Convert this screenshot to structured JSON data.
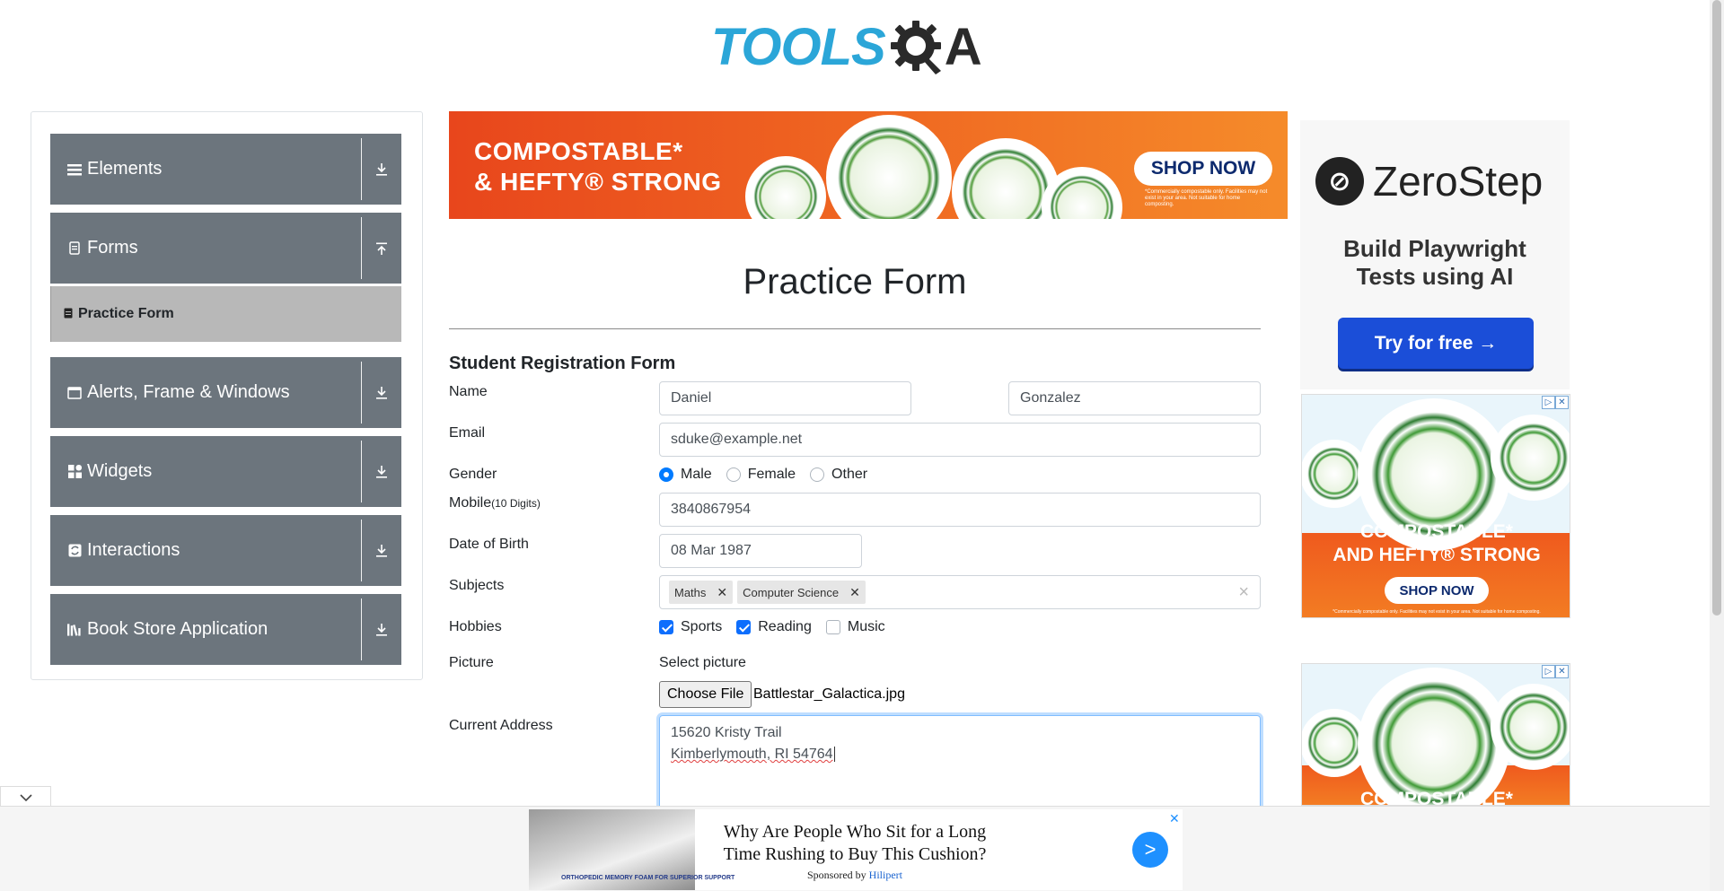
{
  "header": {
    "logo_tools": "TOOLS",
    "logo_a": "A"
  },
  "sidebar": {
    "groups": [
      {
        "label": "Elements",
        "icon": "list-icon",
        "arrow": "⤓"
      },
      {
        "label": "Forms",
        "icon": "form-icon",
        "arrow": "⤒"
      },
      {
        "label": "Alerts, Frame & Windows",
        "icon": "window-icon",
        "arrow": "⤓"
      },
      {
        "label": "Widgets",
        "icon": "widgets-icon",
        "arrow": "⤓"
      },
      {
        "label": "Interactions",
        "icon": "interactions-icon",
        "arrow": "⤓"
      },
      {
        "label": "Book Store Application",
        "icon": "bookstore-icon",
        "arrow": "⤓"
      }
    ],
    "active_subitem": "Practice Form"
  },
  "banner_ad": {
    "line1": "COMPOSTABLE*",
    "line2": "& HEFTY® STRONG",
    "shop": "SHOP NOW",
    "fine": "*Commercially compostable only. Facilities may not exist in your area. Not suitable for home composting."
  },
  "form": {
    "title": "Practice Form",
    "heading": "Student Registration Form",
    "labels": {
      "name": "Name",
      "email": "Email",
      "gender": "Gender",
      "mobile": "Mobile",
      "mobile_hint": "(10 Digits)",
      "dob": "Date of Birth",
      "subjects": "Subjects",
      "hobbies": "Hobbies",
      "picture": "Picture",
      "address": "Current Address"
    },
    "first_name": "Daniel",
    "last_name": "Gonzalez",
    "email": "sduke@example.net",
    "gender_options": [
      "Male",
      "Female",
      "Other"
    ],
    "gender_selected": "Male",
    "mobile": "3840867954",
    "dob": "08 Mar 1987",
    "subjects": [
      "Maths",
      "Computer Science"
    ],
    "subjects_clear": "×",
    "hobbies": [
      {
        "label": "Sports",
        "checked": true
      },
      {
        "label": "Reading",
        "checked": true
      },
      {
        "label": "Music",
        "checked": false
      }
    ],
    "select_picture": "Select picture",
    "choose_file": "Choose File",
    "file_name": "Battlestar_Galactica.jpg",
    "address_line1": "15620 Kristy Trail",
    "address_line2": "Kimberlymouth, RI 54764"
  },
  "zerostep_ad": {
    "name": "ZeroStep",
    "tagline1": "Build Playwright",
    "tagline2": "Tests using AI",
    "button": "Try for free →"
  },
  "side_ad_1": {
    "line1": "COMPOSTABLE*",
    "line2": "AND HEFTY® STRONG",
    "shop": "SHOP NOW",
    "fine": "*Commercially compostable only. Facilities may not exist in your area. Not suitable for home composting."
  },
  "side_ad_2": {
    "line1": "COMPOSTABLE*"
  },
  "bottom_ad": {
    "headline": "Why Are People Who Sit for a Long Time Rushing to Buy This Cushion?",
    "sponsored_prefix": "Sponsored by",
    "sponsor": "Hilipert",
    "image_caption": "ORTHOPEDIC MEMORY FOAM FOR SUPERIOR SUPPORT",
    "go": ">",
    "close": "✕"
  },
  "colors": {
    "sidebar": "#6c757d",
    "accent": "#007bff",
    "logo_blue": "#2ba6d8"
  }
}
